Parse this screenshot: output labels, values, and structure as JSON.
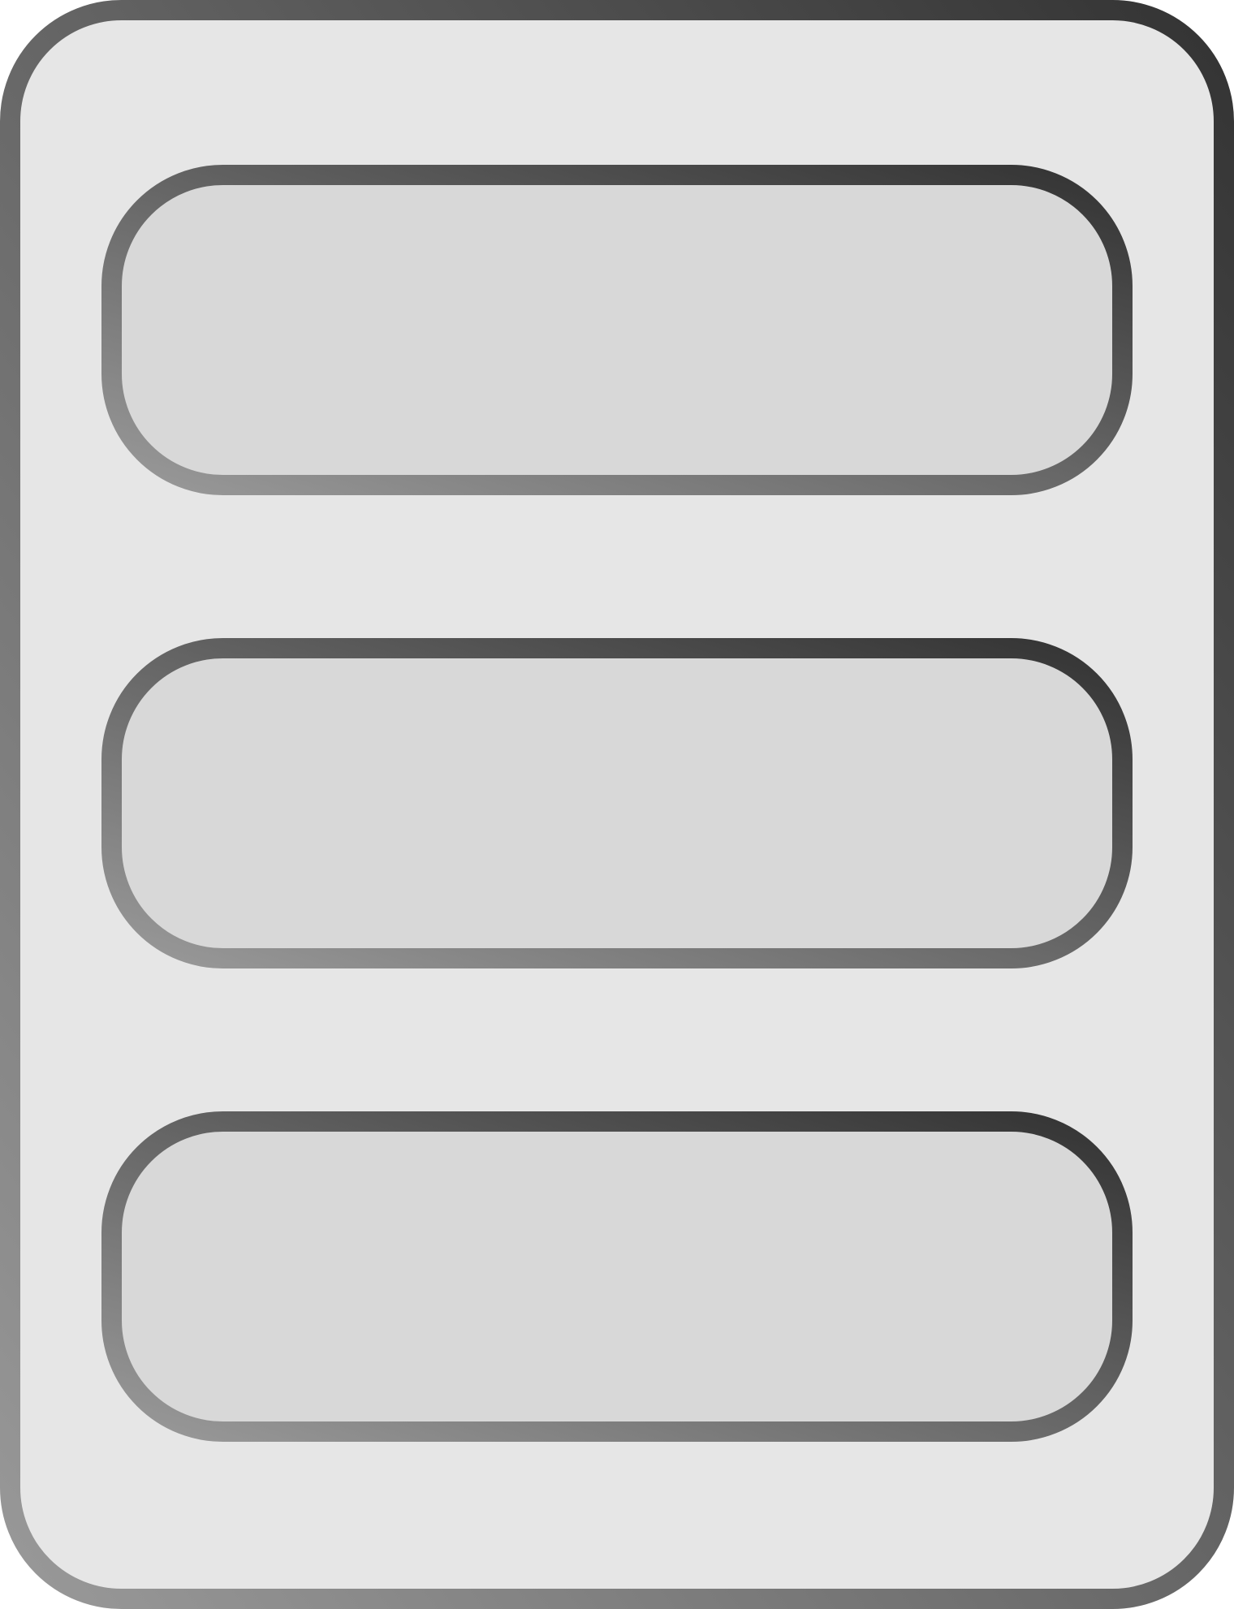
{
  "icon": {
    "name": "list-layout-icon",
    "row_count": 3
  },
  "colors": {
    "outer_fill": "#e6e6e6",
    "inner_fill": "#d8d8d8",
    "stroke_light": "#999999",
    "stroke_dark": "#333333"
  }
}
